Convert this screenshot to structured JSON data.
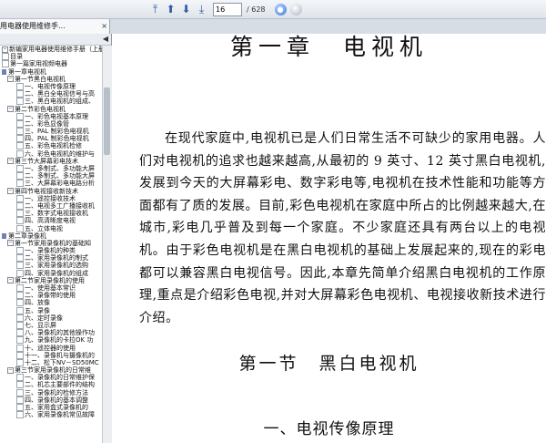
{
  "toolbar": {
    "current_page": "16",
    "total_pages": "/ 628",
    "icons": [
      "first-page-icon",
      "up-arrow-icon",
      "down-arrow-icon",
      "last-page-icon",
      "go-icon",
      "blank-circle-icon"
    ]
  },
  "tab": {
    "title": "用电器使用维修手...",
    "close_label": "×"
  },
  "sidebar": {
    "collapse_label": "◀",
    "items": [
      {
        "label": "新编家用电器使用维修手册（上册",
        "level": 1,
        "type": "root"
      },
      {
        "label": "目录",
        "level": 1,
        "type": "leaf"
      },
      {
        "label": "第一篇家用视频电器",
        "level": 1,
        "type": "leaf"
      },
      {
        "label": "第一章电视机",
        "level": 1,
        "type": "book"
      },
      {
        "label": "第一节黑白电视机",
        "level": 2,
        "type": "open"
      },
      {
        "label": "一、电视传像原理",
        "level": 3,
        "type": "leaf"
      },
      {
        "label": "二、黑白全电视信号与高",
        "level": 3,
        "type": "leaf"
      },
      {
        "label": "三、黑白电视机的组成、",
        "level": 3,
        "type": "leaf"
      },
      {
        "label": "第二节彩色电视机",
        "level": 2,
        "type": "open"
      },
      {
        "label": "一、彩色电视基本原理",
        "level": 3,
        "type": "leaf"
      },
      {
        "label": "二、彩色显像管",
        "level": 3,
        "type": "leaf"
      },
      {
        "label": "三、PAL 制彩色电视机",
        "level": 3,
        "type": "leaf"
      },
      {
        "label": "四、PAL 制彩色电视机",
        "level": 3,
        "type": "leaf"
      },
      {
        "label": "五、彩色电视机检修",
        "level": 3,
        "type": "leaf"
      },
      {
        "label": "六、彩色电视机的维护与",
        "level": 3,
        "type": "leaf"
      },
      {
        "label": "第三节大屏幕彩电技术",
        "level": 2,
        "type": "open"
      },
      {
        "label": "一、多制式、多功能大屏",
        "level": 3,
        "type": "leaf"
      },
      {
        "label": "二、多制式、多功能大屏",
        "level": 3,
        "type": "leaf"
      },
      {
        "label": "三、大屏幕彩电电路分析",
        "level": 3,
        "type": "leaf"
      },
      {
        "label": "第四节电视接收新技术",
        "level": 2,
        "type": "open"
      },
      {
        "label": "一、遥控接收技术",
        "level": 3,
        "type": "leaf"
      },
      {
        "label": "二、电视多工广播接收机",
        "level": 3,
        "type": "leaf"
      },
      {
        "label": "三、数字式电视接收机",
        "level": 3,
        "type": "leaf"
      },
      {
        "label": "四、高清晰度电视",
        "level": 3,
        "type": "leaf"
      },
      {
        "label": "五、立体电视",
        "level": 3,
        "type": "leaf"
      },
      {
        "label": "第二章录像机",
        "level": 1,
        "type": "book"
      },
      {
        "label": "第一节家用录像机的基础知",
        "level": 2,
        "type": "open"
      },
      {
        "label": "一、录像机的种类",
        "level": 3,
        "type": "leaf"
      },
      {
        "label": "二、家用录像机的制式",
        "level": 3,
        "type": "leaf"
      },
      {
        "label": "三、家用录像机的选购",
        "level": 3,
        "type": "leaf"
      },
      {
        "label": "四、家用录像机的组成",
        "level": 3,
        "type": "leaf"
      },
      {
        "label": "第二节家用录像机的使用",
        "level": 2,
        "type": "open"
      },
      {
        "label": "一、使用基本常识",
        "level": 3,
        "type": "leaf"
      },
      {
        "label": "二、录像带的使用",
        "level": 3,
        "type": "leaf"
      },
      {
        "label": "四、放像",
        "level": 3,
        "type": "leaf"
      },
      {
        "label": "五、录像",
        "level": 3,
        "type": "leaf"
      },
      {
        "label": "六、定时录像",
        "level": 3,
        "type": "leaf"
      },
      {
        "label": "七、显示屏",
        "level": 3,
        "type": "leaf"
      },
      {
        "label": "八、录像机的其他操作功",
        "level": 3,
        "type": "leaf"
      },
      {
        "label": "九、录像机的卡拉OK 功",
        "level": 3,
        "type": "leaf"
      },
      {
        "label": "十、遥控器的使用",
        "level": 3,
        "type": "leaf"
      },
      {
        "label": "十一、录像机与摄像机的",
        "level": 3,
        "type": "leaf"
      },
      {
        "label": "十二、松下NV－SD50MC",
        "level": 3,
        "type": "leaf"
      },
      {
        "label": "第三节家用录像机的日常维",
        "level": 2,
        "type": "open"
      },
      {
        "label": "一、录像机的日常维护保",
        "level": 3,
        "type": "leaf"
      },
      {
        "label": "二、机芯主要部件的结构",
        "level": 3,
        "type": "leaf"
      },
      {
        "label": "三、录像机的检修方法",
        "level": 3,
        "type": "leaf"
      },
      {
        "label": "四、录像机的基本调整",
        "level": 3,
        "type": "leaf"
      },
      {
        "label": "五、家用盒式录像机的",
        "level": 3,
        "type": "leaf"
      },
      {
        "label": "六、家用录像机常见故障",
        "level": 3,
        "type": "leaf"
      }
    ]
  },
  "document": {
    "chapter_title": "第一章　电视机",
    "paragraph": "在现代家庭中,电视机已是人们日常生活不可缺少的家用电器。人们对电视机的追求也越来越高,从最初的 9 英寸、12 英寸黑白电视机,发展到今天的大屏幕彩电、数字彩电等,电视机在技术性能和功能等方面都有了质的发展。目前,彩色电视机在家庭中所占的比例越来越大,在城市,彩电几乎普及到每一个家庭。不少家庭还具有两台以上的电视机。由于彩色电视机是在黑白电视机的基础上发展起来的,现在的彩电都可以兼容黑白电视信号。因此,本章先简单介绍黑白电视机的工作原理,重点是介绍彩色电视,并对大屏幕彩色电视机、电视接收新技术进行介绍。",
    "section_title": "第一节　黑白电视机",
    "subsection_title": "一、电视传像原理"
  }
}
